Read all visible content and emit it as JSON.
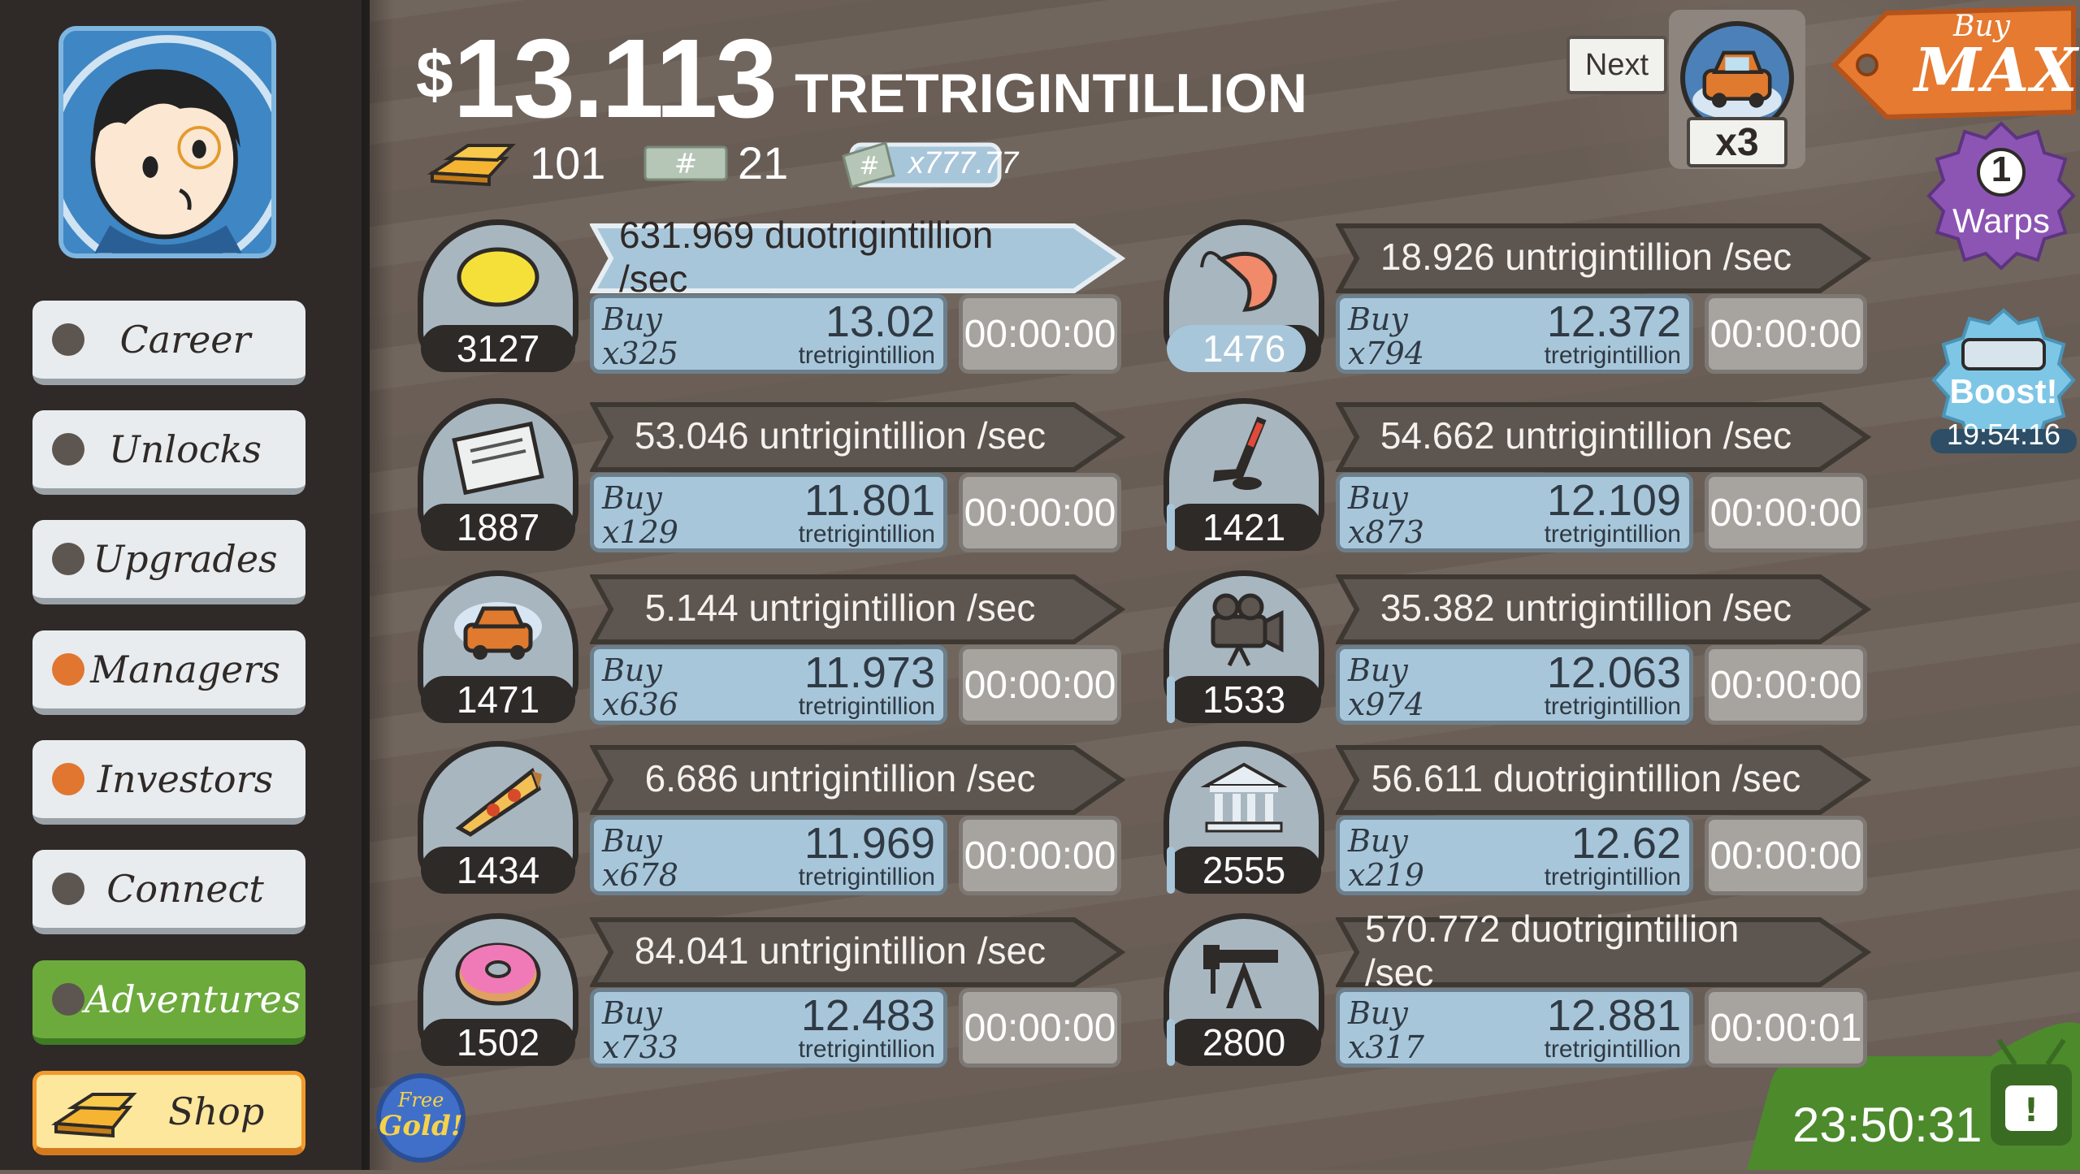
{
  "header": {
    "currency_symbol": "$",
    "money_amount": "13.113",
    "money_unit": "TRETRIGINTILLION",
    "gold_count": "101",
    "megaticket_count": "21",
    "multiplier_label": "x777.77"
  },
  "sidebar": {
    "items": [
      {
        "label": "Career",
        "indicator": "gray"
      },
      {
        "label": "Unlocks",
        "indicator": "gray"
      },
      {
        "label": "Upgrades",
        "indicator": "gray"
      },
      {
        "label": "Managers",
        "indicator": "orange"
      },
      {
        "label": "Investors",
        "indicator": "orange"
      },
      {
        "label": "Connect",
        "indicator": "gray"
      },
      {
        "label": "Adventures",
        "indicator": "gray"
      },
      {
        "label": "Shop",
        "indicator": "none"
      }
    ]
  },
  "top_right": {
    "next_label": "Next",
    "next_multiplier": "x3",
    "buy_label": "Buy",
    "max_label": "MAX",
    "warps_count": "1",
    "warps_label": "Warps",
    "boost_label": "Boost!",
    "boost_timer": "19:54:16",
    "free_gold_line1": "Free",
    "free_gold_line2": "Gold!",
    "event_timer": "23:50:31"
  },
  "businesses": [
    {
      "icon": "lemon-icon",
      "owned": "3127",
      "progress": 1.0,
      "rate": "631.969 duotrigintillion /sec",
      "highlight": true,
      "buy_label": "Buy",
      "buy_qty": "x325",
      "price": "13.02",
      "price_unit": "tretrigintillion",
      "timer": "00:00:00"
    },
    {
      "icon": "newspaper-icon",
      "owned": "1887",
      "progress": 1.0,
      "rate": "53.046 untrigintillion /sec",
      "highlight": false,
      "buy_label": "Buy",
      "buy_qty": "x129",
      "price": "11.801",
      "price_unit": "tretrigintillion",
      "timer": "00:00:00"
    },
    {
      "icon": "car-wash-icon",
      "owned": "1471",
      "progress": 1.0,
      "rate": "5.144 untrigintillion /sec",
      "highlight": false,
      "buy_label": "Buy",
      "buy_qty": "x636",
      "price": "11.973",
      "price_unit": "tretrigintillion",
      "timer": "00:00:00"
    },
    {
      "icon": "pizza-icon",
      "owned": "1434",
      "progress": 1.0,
      "rate": "6.686 untrigintillion /sec",
      "highlight": false,
      "buy_label": "Buy",
      "buy_qty": "x678",
      "price": "11.969",
      "price_unit": "tretrigintillion",
      "timer": "00:00:00"
    },
    {
      "icon": "donut-icon",
      "owned": "1502",
      "progress": 1.0,
      "rate": "84.041 untrigintillion /sec",
      "highlight": false,
      "buy_label": "Buy",
      "buy_qty": "x733",
      "price": "12.483",
      "price_unit": "tretrigintillion",
      "timer": "00:00:00"
    },
    {
      "icon": "shrimp-icon",
      "owned": "1476",
      "progress": 0.9,
      "rate": "18.926 untrigintillion /sec",
      "highlight": false,
      "buy_label": "Buy",
      "buy_qty": "x794",
      "price": "12.372",
      "price_unit": "tretrigintillion",
      "timer": "00:00:00"
    },
    {
      "icon": "hockey-icon",
      "owned": "1421",
      "progress": 0.05,
      "rate": "54.662 untrigintillion /sec",
      "highlight": false,
      "buy_label": "Buy",
      "buy_qty": "x873",
      "price": "12.109",
      "price_unit": "tretrigintillion",
      "timer": "00:00:00"
    },
    {
      "icon": "movie-camera-icon",
      "owned": "1533",
      "progress": 0.05,
      "rate": "35.382 untrigintillion /sec",
      "highlight": false,
      "buy_label": "Buy",
      "buy_qty": "x974",
      "price": "12.063",
      "price_unit": "tretrigintillion",
      "timer": "00:00:00"
    },
    {
      "icon": "bank-icon",
      "owned": "2555",
      "progress": 0.05,
      "rate": "56.611 duotrigintillion /sec",
      "highlight": false,
      "buy_label": "Buy",
      "buy_qty": "x219",
      "price": "12.62",
      "price_unit": "tretrigintillion",
      "timer": "00:00:00"
    },
    {
      "icon": "oil-rig-icon",
      "owned": "2800",
      "progress": 0.05,
      "rate": "570.772 duotrigintillion /sec",
      "highlight": false,
      "buy_label": "Buy",
      "buy_qty": "x317",
      "price": "12.881",
      "price_unit": "tretrigintillion",
      "timer": "00:00:01"
    }
  ],
  "colors": {
    "sidebar_bg": "#2f2a28",
    "background": "#6e6259",
    "buy_bg": "#a8c6da",
    "adventures_green": "#6caa3c",
    "shop_yellow": "#fde79c",
    "indicator_orange": "#e0762f"
  }
}
